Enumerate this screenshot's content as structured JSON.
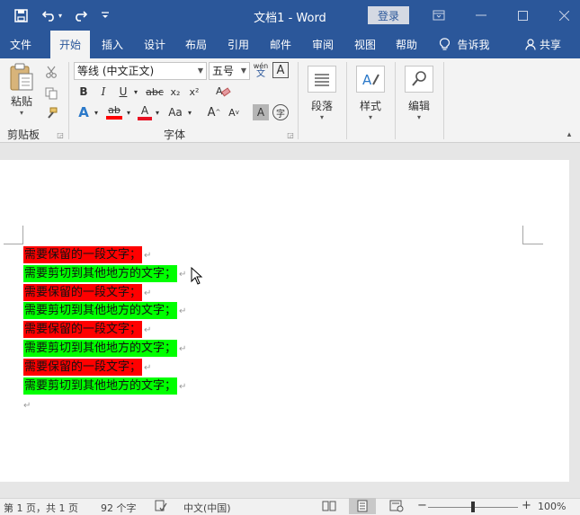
{
  "app": {
    "title": "文档1 - Word",
    "login_label": "登录",
    "qat_customize": "₹"
  },
  "tabs": [
    {
      "label": "文件"
    },
    {
      "label": "开始"
    },
    {
      "label": "插入"
    },
    {
      "label": "设计"
    },
    {
      "label": "布局"
    },
    {
      "label": "引用"
    },
    {
      "label": "邮件"
    },
    {
      "label": "审阅"
    },
    {
      "label": "视图"
    },
    {
      "label": "帮助"
    },
    {
      "label": "告诉我"
    },
    {
      "label": "共享"
    }
  ],
  "ribbon": {
    "clipboard": {
      "paste_label": "粘贴",
      "group_label": "剪贴板"
    },
    "font": {
      "font_name": "等线 (中文正文)",
      "font_size": "五号",
      "wen_label": "wén",
      "wen_char": "文",
      "bold": "B",
      "italic": "I",
      "underline": "U",
      "strike": "abc",
      "subscript": "x₂",
      "superscript": "x²",
      "text_effect": "A",
      "highlight": "ab",
      "font_color": "A",
      "change_case": "Aa",
      "grow": "A",
      "shrink": "A",
      "char_shading": "A",
      "enclose": "字",
      "group_label": "字体"
    },
    "paragraph": {
      "label": "段落"
    },
    "styles": {
      "label": "样式"
    },
    "editing": {
      "label": "编辑"
    }
  },
  "document": {
    "lines": [
      {
        "text": "需要保留的一段文字；",
        "highlight": "#ff0000"
      },
      {
        "text": "需要剪切到其他地方的文字；",
        "highlight": "#00ff00"
      },
      {
        "text": "需要保留的一段文字；",
        "highlight": "#ff0000"
      },
      {
        "text": "需要剪切到其他地方的文字；",
        "highlight": "#00ff00"
      },
      {
        "text": "需要保留的一段文字；",
        "highlight": "#ff0000"
      },
      {
        "text": "需要剪切到其他地方的文字；",
        "highlight": "#00ff00"
      },
      {
        "text": "需要保留的一段文字；",
        "highlight": "#ff0000"
      },
      {
        "text": "需要剪切到其他地方的文字；",
        "highlight": "#00ff00"
      }
    ],
    "paragraph_mark": "↵"
  },
  "statusbar": {
    "page_info": "第 1 页，共 1 页",
    "word_count": "92 个字",
    "language": "中文(中国)",
    "zoom": "100%",
    "zoom_minus": "−",
    "zoom_plus": "+"
  },
  "colors": {
    "title_blue": "#2b579a",
    "red_highlight": "#ff0000",
    "green_highlight": "#00ff00"
  }
}
